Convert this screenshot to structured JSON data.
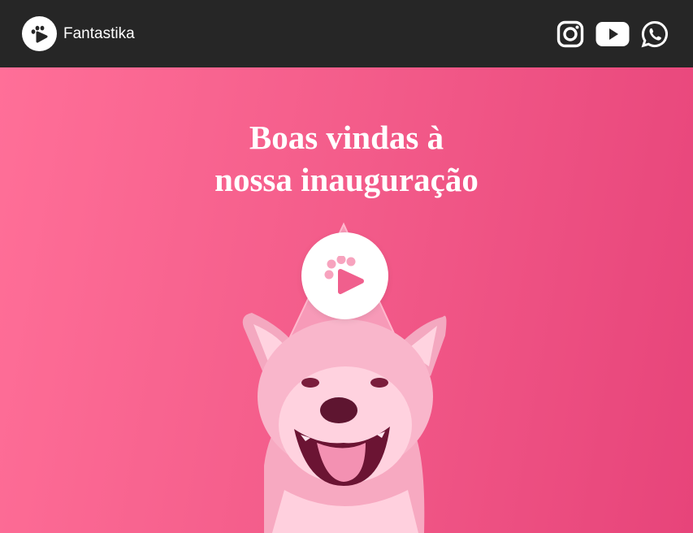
{
  "header": {
    "brand_name": "Fantastika",
    "logo_icon": "paw-icon",
    "social": [
      {
        "name": "instagram",
        "icon": "instagram-icon"
      },
      {
        "name": "youtube",
        "icon": "youtube-icon"
      },
      {
        "name": "whatsapp",
        "icon": "whatsapp-icon"
      }
    ]
  },
  "hero": {
    "title_line1": "Boas vindas à",
    "title_line2": "nossa inauguração",
    "play_icon": "paw-play-icon",
    "image": "dog-with-party-hat"
  },
  "colors": {
    "header_bg": "#262626",
    "hero_pink": "#f45d8b",
    "text": "#ffffff"
  }
}
